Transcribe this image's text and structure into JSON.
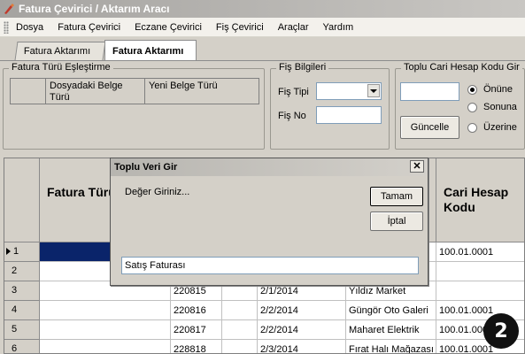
{
  "window": {
    "title": "Fatura Çevirici / Aktarım Aracı"
  },
  "menu": [
    "Dosya",
    "Fatura Çevirici",
    "Eczane Çevirici",
    "Fiş Çevirici",
    "Araçlar",
    "Yardım"
  ],
  "tabs": [
    "Fatura Aktarımı",
    "Fatura Aktarımı"
  ],
  "group_mapping": {
    "legend": "Fatura Türü Eşleştirme",
    "col1": "Dosyadaki Belge Türü",
    "col2": "Yeni Belge Türü"
  },
  "group_fis": {
    "legend": "Fiş Bilgileri",
    "type_label": "Fiş Tipi",
    "no_label": "Fiş No"
  },
  "group_cari": {
    "legend": "Toplu Cari Hesap Kodu Gir",
    "button": "Güncelle",
    "radio_options": [
      "Önüne",
      "Sonuna",
      "Üzerine"
    ],
    "selected": "Önüne"
  },
  "grid": {
    "headers": {
      "fatura_turu": "Fatura Türü",
      "cari": "Cari Hesap Kodu"
    },
    "rows": [
      {
        "num": "1",
        "fatura_no": "",
        "date": "",
        "name": "",
        "cari": "100.01.0001"
      },
      {
        "num": "2",
        "fatura_no": "",
        "date": "",
        "name": "",
        "cari": ""
      },
      {
        "num": "3",
        "fatura_no": "220815",
        "date": "2/1/2014",
        "name": "Yıldız Market",
        "cari": ""
      },
      {
        "num": "4",
        "fatura_no": "220816",
        "date": "2/2/2014",
        "name": "Güngör Oto Galeri",
        "cari": "100.01.0001"
      },
      {
        "num": "5",
        "fatura_no": "220817",
        "date": "2/2/2014",
        "name": "Maharet Elektrik",
        "cari": "100.01.0001"
      },
      {
        "num": "6",
        "fatura_no": "228818",
        "date": "2/3/2014",
        "name": "Fırat Halı Mağazası",
        "cari": "100.01.0001"
      }
    ]
  },
  "dialog": {
    "title": "Toplu Veri Gir",
    "prompt": "Değer Giriniz...",
    "ok": "Tamam",
    "cancel": "İptal",
    "input_value": "Satış Faturası"
  },
  "badge": "2"
}
